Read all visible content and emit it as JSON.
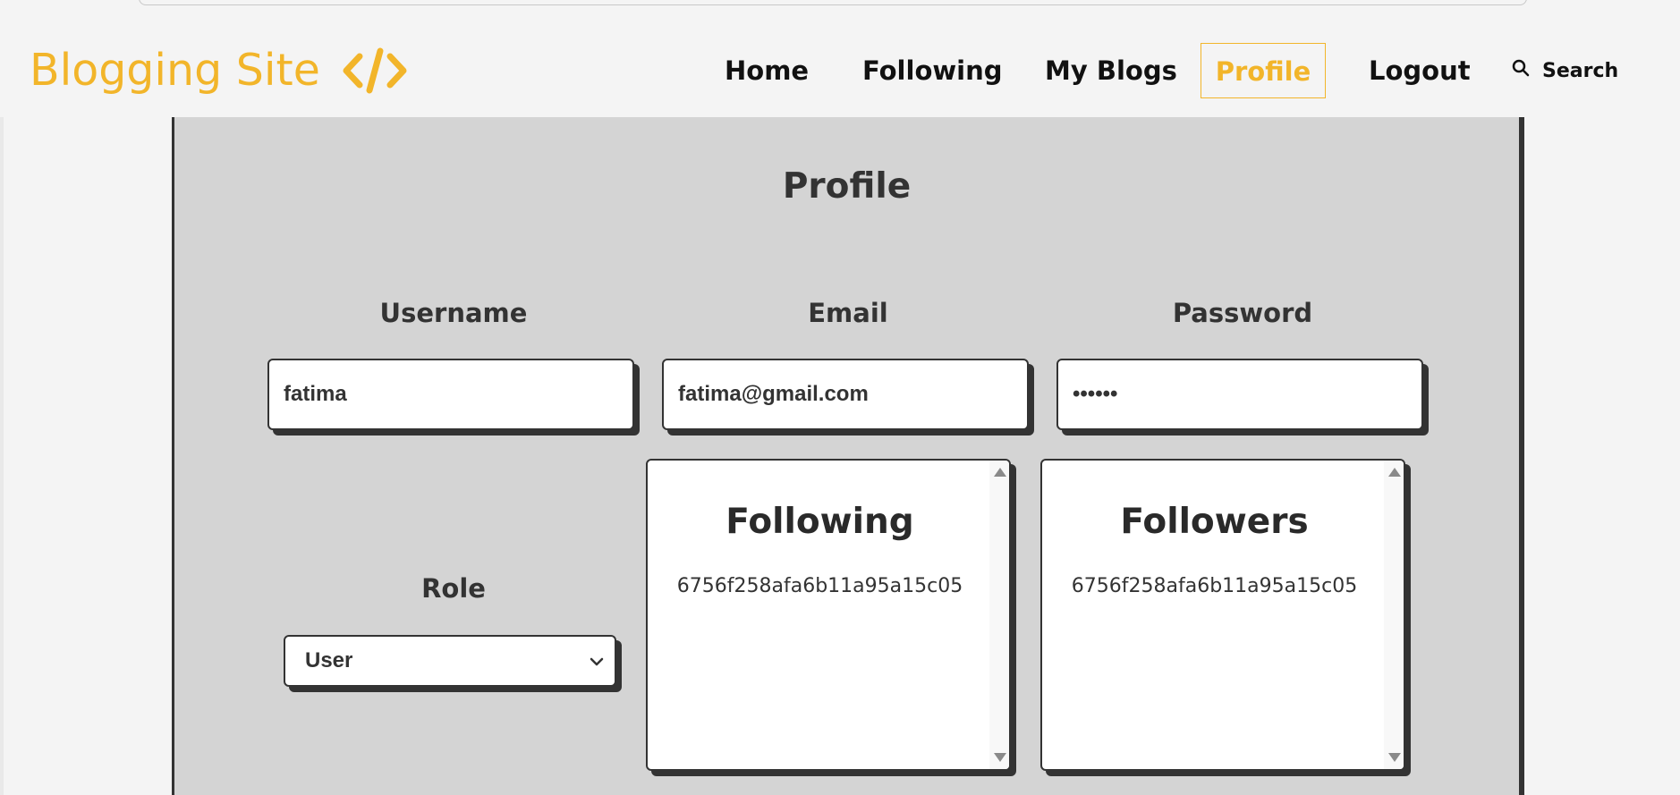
{
  "brand": {
    "name": "Blogging Site",
    "icon": "code-brackets-icon",
    "color": "#f2b52a"
  },
  "nav": {
    "items": [
      {
        "label": "Home"
      },
      {
        "label": "Following"
      },
      {
        "label": "My Blogs"
      },
      {
        "label": "Profile",
        "active": true
      },
      {
        "label": "Logout"
      }
    ],
    "search_label": "Search"
  },
  "profile": {
    "title": "Profile",
    "username_label": "Username",
    "username_value": "fatima",
    "email_label": "Email",
    "email_value": "fatima@gmail.com",
    "password_label": "Password",
    "password_value": "••••••",
    "role_label": "Role",
    "role_value": "User",
    "following": {
      "title": "Following",
      "items": [
        "6756f258afa6b11a95a15c05"
      ]
    },
    "followers": {
      "title": "Followers",
      "items": [
        "6756f258afa6b11a95a15c05"
      ]
    }
  }
}
